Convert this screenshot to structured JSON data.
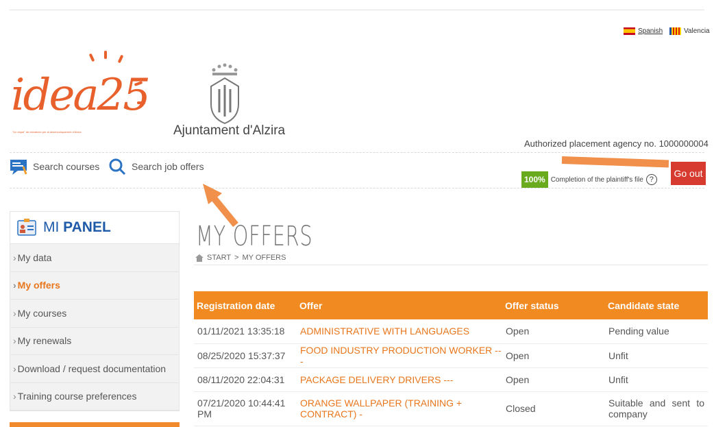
{
  "languages": {
    "spanish": "Spanish",
    "valencia": "Valencia"
  },
  "logos": {
    "idea_word": "idea25",
    "idea_tagline": "\"Un espai\" de iniciatives per al desenvolupament d'Alzira",
    "city": "Ajuntament d'Alzira"
  },
  "header": {
    "agency": "Authorized placement agency no. 1000000004",
    "completion_pct": "100%",
    "completion_label": "Completion of the plaintiff's file",
    "help_symbol": "?",
    "go_out": "Go out"
  },
  "nav": {
    "search_courses": "Search courses",
    "search_jobs": "Search job offers"
  },
  "sidebar": {
    "title_prefix": "MI",
    "title": "PANEL",
    "items": [
      {
        "label": "My data",
        "active": false
      },
      {
        "label": "My offers",
        "active": true
      },
      {
        "label": "My courses",
        "active": false
      },
      {
        "label": "My renewals",
        "active": false
      },
      {
        "label": "Download / request documentation",
        "active": false
      },
      {
        "label": "Training course preferences",
        "active": false
      }
    ]
  },
  "main": {
    "title": "MY OFFERS",
    "breadcrumb_start": "START",
    "breadcrumb_sep": ">",
    "breadcrumb_current": "MY OFFERS"
  },
  "table": {
    "headers": [
      "Registration date",
      "Offer",
      "Offer status",
      "Candidate state"
    ],
    "rows": [
      [
        "01/11/2021 13:35:18",
        "ADMINISTRATIVE WITH LANGUAGES",
        "Open",
        "Pending value"
      ],
      [
        "08/25/2020 15:37:37",
        "FOOD INDUSTRY PRODUCTION WORKER ---",
        "Open",
        "Unfit"
      ],
      [
        "08/11/2020 22:04:31",
        "PACKAGE DELIVERY DRIVERS ---",
        "Open",
        "Unfit"
      ],
      [
        "07/21/2020 10:44:41 PM",
        "ORANGE WALLPAPER (TRAINING + CONTRACT) -",
        "Closed",
        "Suitable and sent to company"
      ]
    ]
  },
  "colors": {
    "accent_orange": "#f18a21",
    "go_out_red": "#d73a2e",
    "completion_green": "#6aaa1e",
    "panel_blue": "#1e5aa8",
    "annotation_arrow": "#f0904a"
  }
}
